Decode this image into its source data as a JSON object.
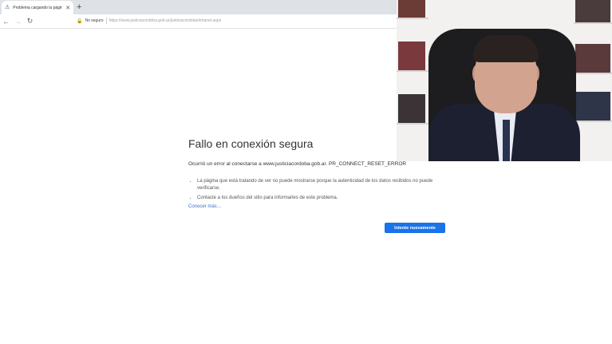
{
  "browser": {
    "tab_title": "Problema cargando la página",
    "new_tab_icon": "+",
    "back_icon": "←",
    "forward_icon": "→",
    "reload_icon": "↻",
    "security_label": "No seguro",
    "url": "https://www.justiciacordoba.gob.ar/justiciacordoba/intranet.aspx"
  },
  "error_page": {
    "title": "Fallo en conexión segura",
    "message": "Ocurrió un error al conectarse a www.justiciacordoba.gob.ar. PR_CONNECT_RESET_ERROR",
    "bullets": [
      "La página que está tratando de ver no puede mostrarse porque la autenticidad de los datos recibidos no puede verificarse.",
      "Contacte a los dueños del sitio para informarles de este problema."
    ],
    "learn_more": "Conocer más…",
    "retry_button": "Intente nuevamente"
  },
  "colors": {
    "accent": "#1a73e8",
    "link": "#3572c6",
    "tabbar": "#dee1e6"
  }
}
